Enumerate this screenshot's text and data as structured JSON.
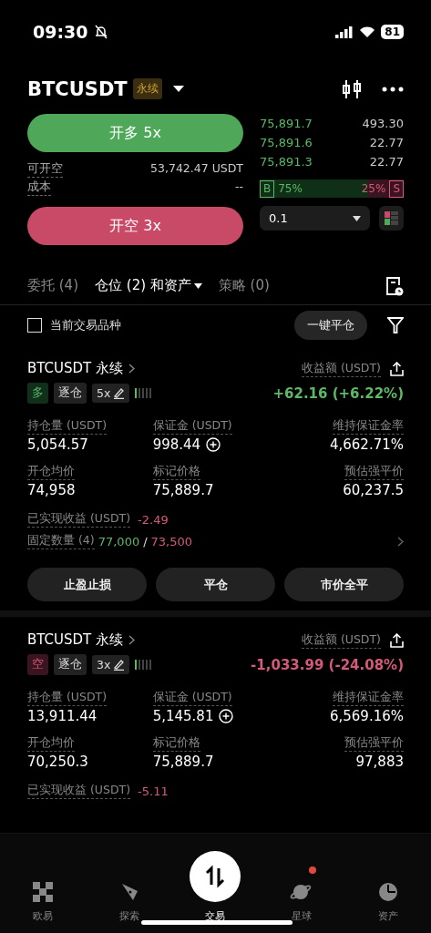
{
  "status_bar": {
    "time": "09:30",
    "battery": "81"
  },
  "header": {
    "symbol": "BTCUSDT",
    "tag": "永续"
  },
  "trade": {
    "long_button": "开多 5x",
    "short_button": "开空 3x",
    "info": [
      {
        "label": "可开空",
        "value": "53,742.47 USDT"
      },
      {
        "label": "成本",
        "value": "--"
      }
    ]
  },
  "order_book": {
    "rows": [
      {
        "price": "75,891.7",
        "size": "493.30"
      },
      {
        "price": "75,891.6",
        "size": "22.77"
      },
      {
        "price": "75,891.3",
        "size": "22.77"
      }
    ],
    "ratio": {
      "buy_label": "B",
      "buy_pct": "75%",
      "sell_pct": "25%",
      "sell_label": "S",
      "level": 0.75
    },
    "step_select": "0.1"
  },
  "tabs": [
    {
      "label": "委托 (4)",
      "selected": false,
      "has_menu": false
    },
    {
      "label": "仓位 (2) 和资产",
      "selected": true,
      "has_menu": true
    },
    {
      "label": "策略 (0)",
      "selected": false,
      "has_menu": false
    }
  ],
  "filter": {
    "label": "当前交易品种",
    "checked": false,
    "close_all": "一键平仓"
  },
  "positions": [
    {
      "title": "BTCUSDT 永续",
      "side": "多",
      "kind": "long",
      "margin_mode": "逐仓",
      "leverage": "5x",
      "pnl_label": "收益额 (USDT)",
      "pnl": "+62.16 (+6.22%)",
      "stats": [
        {
          "label": "持仓量 (USDT)",
          "value": "5,054.57",
          "add": false
        },
        {
          "label": "保证金 (USDT)",
          "value": "998.44",
          "add": true
        },
        {
          "label": "维持保证金率",
          "value": "4,662.71%",
          "add": false
        },
        {
          "label": "开仓均价",
          "value": "74,958",
          "add": false
        },
        {
          "label": "标记价格",
          "value": "75,889.7",
          "add": false
        },
        {
          "label": "预估强平价",
          "value": "60,237.5",
          "add": false
        }
      ],
      "realized": {
        "label": "已实现收益 (USDT)",
        "value": "-2.49"
      },
      "fixed": {
        "label": "固定数量 (4)",
        "take_profit": "77,000",
        "separator": "/",
        "stop_loss": "73,500"
      },
      "actions": [
        "止盈止损",
        "平仓",
        "市价全平"
      ]
    },
    {
      "title": "BTCUSDT 永续",
      "side": "空",
      "kind": "short",
      "margin_mode": "逐仓",
      "leverage": "3x",
      "pnl_label": "收益额 (USDT)",
      "pnl": "-1,033.99 (-24.08%)",
      "stats": [
        {
          "label": "持仓量 (USDT)",
          "value": "13,911.44",
          "add": false
        },
        {
          "label": "保证金 (USDT)",
          "value": "5,145.81",
          "add": true
        },
        {
          "label": "维持保证金率",
          "value": "6,569.16%",
          "add": false
        },
        {
          "label": "开仓均价",
          "value": "70,250.3",
          "add": false
        },
        {
          "label": "标记价格",
          "value": "75,889.7",
          "add": false
        },
        {
          "label": "预估强平价",
          "value": "97,883",
          "add": false
        }
      ],
      "realized": {
        "label": "已实现收益 (USDT)",
        "value": "-5.11"
      }
    }
  ],
  "bottom_nav": [
    {
      "label": "欧易",
      "selected": false,
      "badge": false
    },
    {
      "label": "探索",
      "selected": false,
      "badge": false
    },
    {
      "label": "交易",
      "selected": true,
      "badge": false
    },
    {
      "label": "星球",
      "selected": false,
      "badge": true
    },
    {
      "label": "资产",
      "selected": false,
      "badge": false
    }
  ]
}
